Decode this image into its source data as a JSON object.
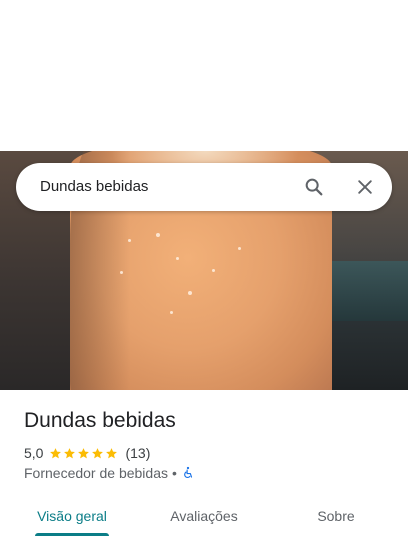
{
  "search": {
    "query": "Dundas bebidas"
  },
  "icons": {
    "search": "search-icon",
    "close": "close-icon",
    "star": "star-icon",
    "accessibility": "wheelchair-icon"
  },
  "place": {
    "name": "Dundas bebidas",
    "rating": "5,0",
    "stars": 5,
    "reviews_count": "(13)",
    "category": "Fornecedor de bebidas",
    "separator": "•"
  },
  "tabs": [
    {
      "label": "Visão geral",
      "active": true
    },
    {
      "label": "Avaliações",
      "active": false
    },
    {
      "label": "Sobre",
      "active": false
    }
  ],
  "colors": {
    "accent": "#0b7d87",
    "star": "#fbbc04",
    "accessibility": "#1a73e8"
  }
}
